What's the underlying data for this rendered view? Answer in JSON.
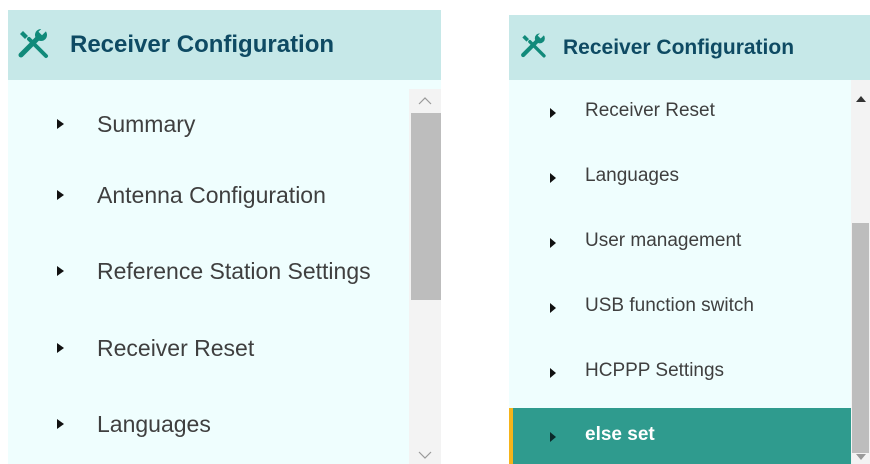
{
  "colors": {
    "header_bg": "#c6e8e8",
    "panel_bg": "#effefe",
    "title_text": "#0e4a63",
    "active_bg": "#2f9b8e",
    "active_border": "#f5b41a"
  },
  "left_panel": {
    "title": "Receiver Configuration",
    "header_icon": "tools-icon",
    "items": [
      {
        "label": "Summary"
      },
      {
        "label": "Antenna Configuration"
      },
      {
        "label": "Reference Station Settings"
      },
      {
        "label": "Receiver Reset"
      },
      {
        "label": "Languages"
      }
    ]
  },
  "right_panel": {
    "title": "Receiver Configuration",
    "header_icon": "tools-icon",
    "items": [
      {
        "label": "Receiver Reset"
      },
      {
        "label": "Languages"
      },
      {
        "label": "User management"
      },
      {
        "label": "USB function switch"
      },
      {
        "label": "HCPPP Settings"
      },
      {
        "label": "else set",
        "active": true
      }
    ]
  }
}
